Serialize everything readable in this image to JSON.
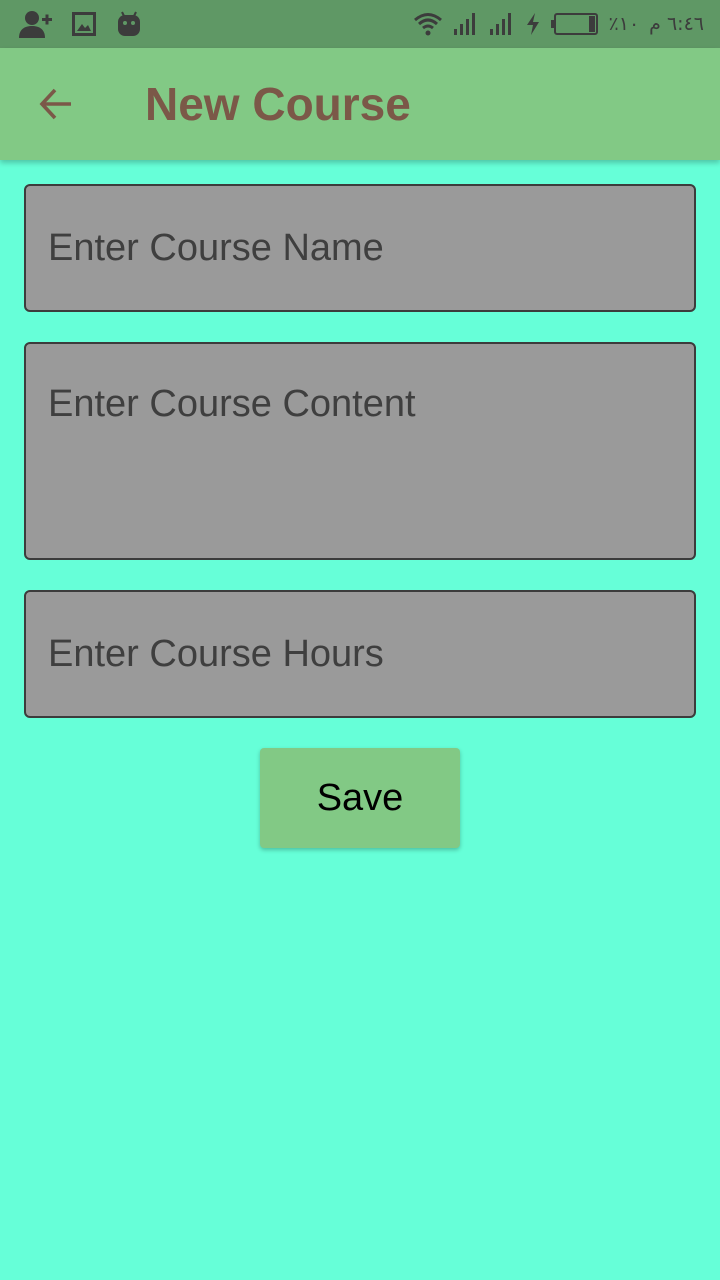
{
  "status_bar": {
    "time": "٦:٤٦ م",
    "battery": "٪١٠",
    "left_icons": [
      "add-user-icon",
      "image-icon",
      "android-icon"
    ],
    "right_icons": [
      "wifi-icon",
      "signal-icon",
      "signal-icon",
      "charging-icon",
      "battery-icon"
    ]
  },
  "app_bar": {
    "title": "New Course",
    "back_icon": "arrow-left-icon"
  },
  "form": {
    "name_placeholder": "Enter Course Name",
    "content_placeholder": "Enter Course Content",
    "hours_placeholder": "Enter Course Hours",
    "save_label": "Save"
  },
  "colors": {
    "background": "#66ffd8",
    "status_bar": "#5f9865",
    "app_bar": "#82c985",
    "title": "#7b5848",
    "field_bg": "#9a9a9a",
    "button": "#82c985"
  }
}
